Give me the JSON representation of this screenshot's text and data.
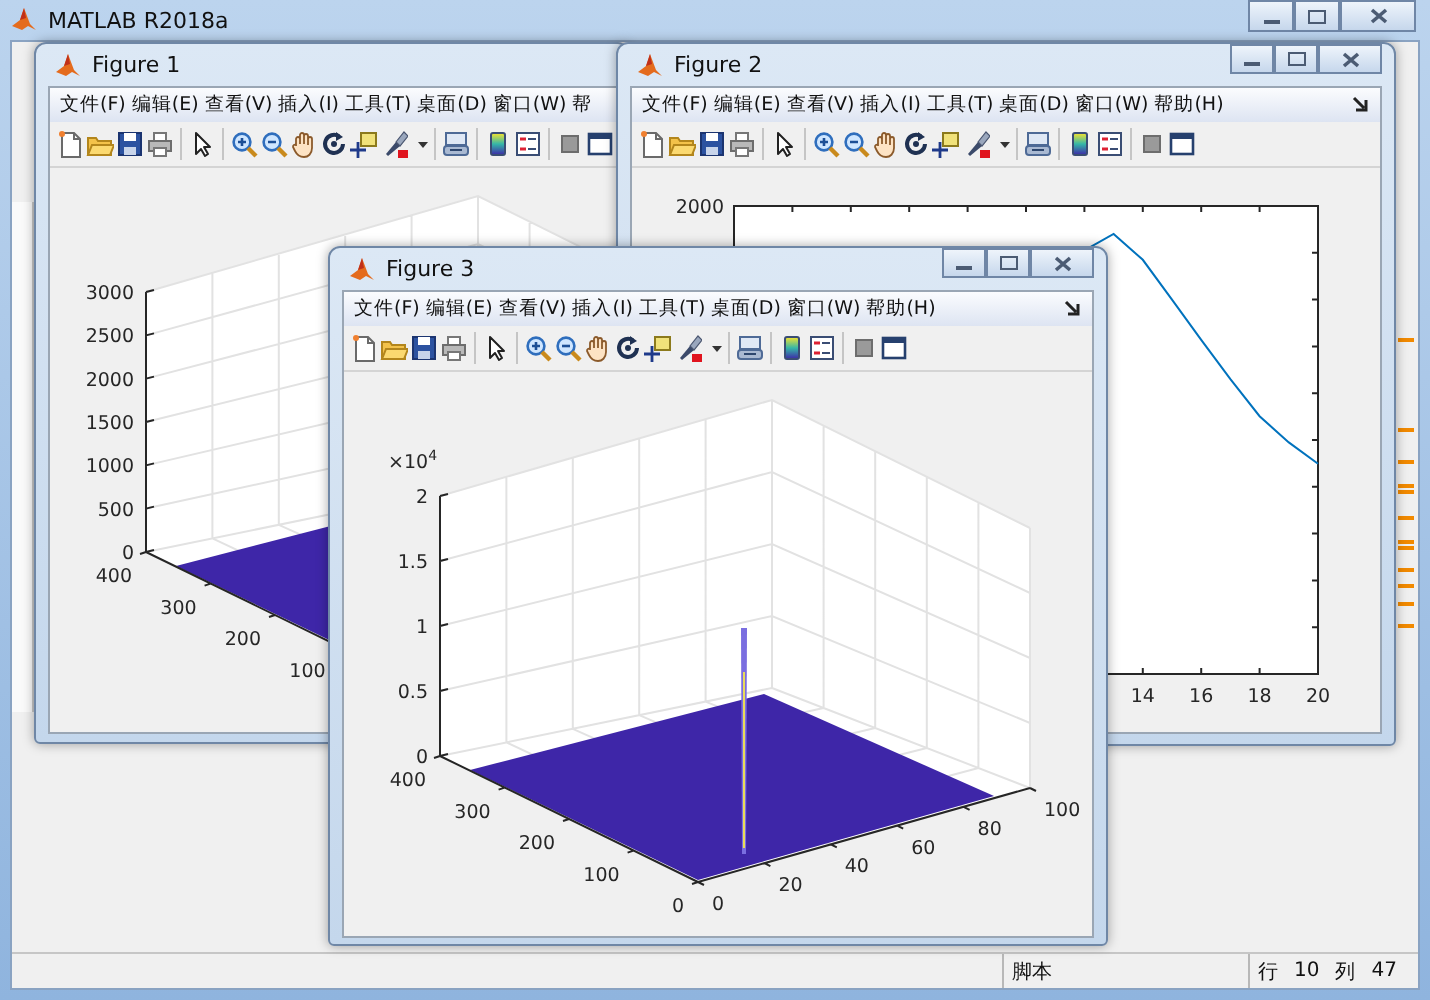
{
  "window": {
    "title": "MATLAB R2018a"
  },
  "figures": [
    {
      "title": "Figure 1",
      "menu": [
        "文件(F)",
        "编辑(E)",
        "查看(V)",
        "插入(I)",
        "工具(T)",
        "桌面(D)",
        "窗口(W)",
        "帮"
      ],
      "plot": {
        "kind": "surface3d",
        "z_ticks": [
          "3000",
          "2500",
          "2000",
          "1500",
          "1000",
          "500",
          "0"
        ],
        "y_ticks": [
          "400",
          "300",
          "200",
          "100"
        ]
      }
    },
    {
      "title": "Figure 2",
      "menu": [
        "文件(F)",
        "编辑(E)",
        "查看(V)",
        "插入(I)",
        "工具(T)",
        "桌面(D)",
        "窗口(W)",
        "帮助(H)"
      ],
      "plot": {
        "kind": "line",
        "y_tick_labels": [
          "2000"
        ],
        "x_tick_labels": [
          "14",
          "16",
          "18",
          "20"
        ]
      }
    },
    {
      "title": "Figure 3",
      "menu": [
        "文件(F)",
        "编辑(E)",
        "查看(V)",
        "插入(I)",
        "工具(T)",
        "桌面(D)",
        "窗口(W)",
        "帮助(H)"
      ],
      "plot": {
        "kind": "surface3d",
        "exponent": "×10$^{4}$",
        "spike": true,
        "z_ticks": [
          "2",
          "1.5",
          "1",
          "0.5",
          "0"
        ],
        "y_ticks": [
          "400",
          "300",
          "200",
          "100",
          "0"
        ],
        "x_ticks": [
          "0",
          "20",
          "40",
          "60",
          "80",
          "100"
        ]
      }
    }
  ],
  "status_bar": {
    "file_type": "脚本",
    "line_label": "行",
    "line": "10",
    "column_label": "列",
    "column": "47"
  }
}
